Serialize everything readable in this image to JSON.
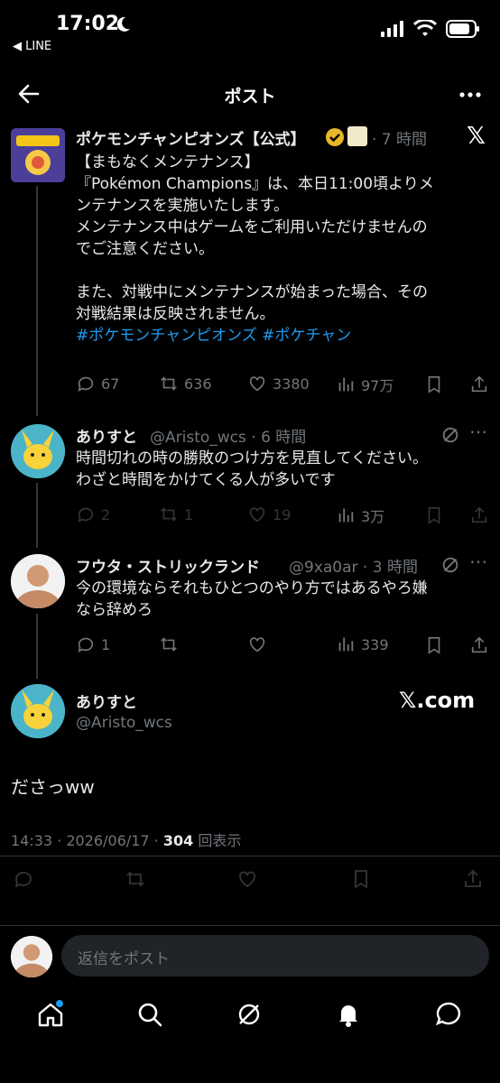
{
  "status": {
    "time": "17:02",
    "back_app": "◀ LINE"
  },
  "header": {
    "title": "ポスト"
  },
  "tweet1": {
    "name": "ポケモンチャンピオンズ【公式】",
    "time": "· 7 時間",
    "lines": [
      "【まもなくメンテナンス】",
      "『Pokémon Champions』は、本日11:00頃よりメ",
      "ンテナンスを実施いたします。",
      "メンテナンス中はゲームをご利用いただけませんの",
      "でご注意ください。",
      "",
      "また、対戦中にメンテナンスが始まった場合、その",
      "対戦結果は反映されません。"
    ],
    "hashtags": "#ポケモンチャンピオンズ #ポケチャン",
    "replies": "67",
    "retweets": "636",
    "likes": "3380",
    "views": "97万"
  },
  "tweet2": {
    "name": "ありすと",
    "handle": "@Aristo_wcs · 6 時間",
    "lines": [
      "時間切れの時の勝敗のつけ方を見直してください。",
      "わざと時間をかけてくる人が多いです"
    ],
    "replies": "2",
    "retweets": "1",
    "likes": "19",
    "views": "3万"
  },
  "tweet3": {
    "name": "フウタ・ストリックランド",
    "handle": "@9xa0ar · 3 時間",
    "lines": [
      "今の環境ならそれもひとつのやり方ではあるやろ嫌",
      "なら辞めろ"
    ],
    "replies": "1",
    "views": "339"
  },
  "main_tweet": {
    "name": "ありすと",
    "handle": "@Aristo_wcs",
    "source": "𝕏.com",
    "text": "ださっww",
    "meta_time": "14:33 · 2026/06/17 · ",
    "meta_views": "304",
    "meta_views_label": " 回表示"
  },
  "reply_box": {
    "placeholder": "返信をポスト"
  },
  "colors": {
    "accent": "#1d9bf0",
    "verified": "#e8b829",
    "background": "#000000"
  }
}
